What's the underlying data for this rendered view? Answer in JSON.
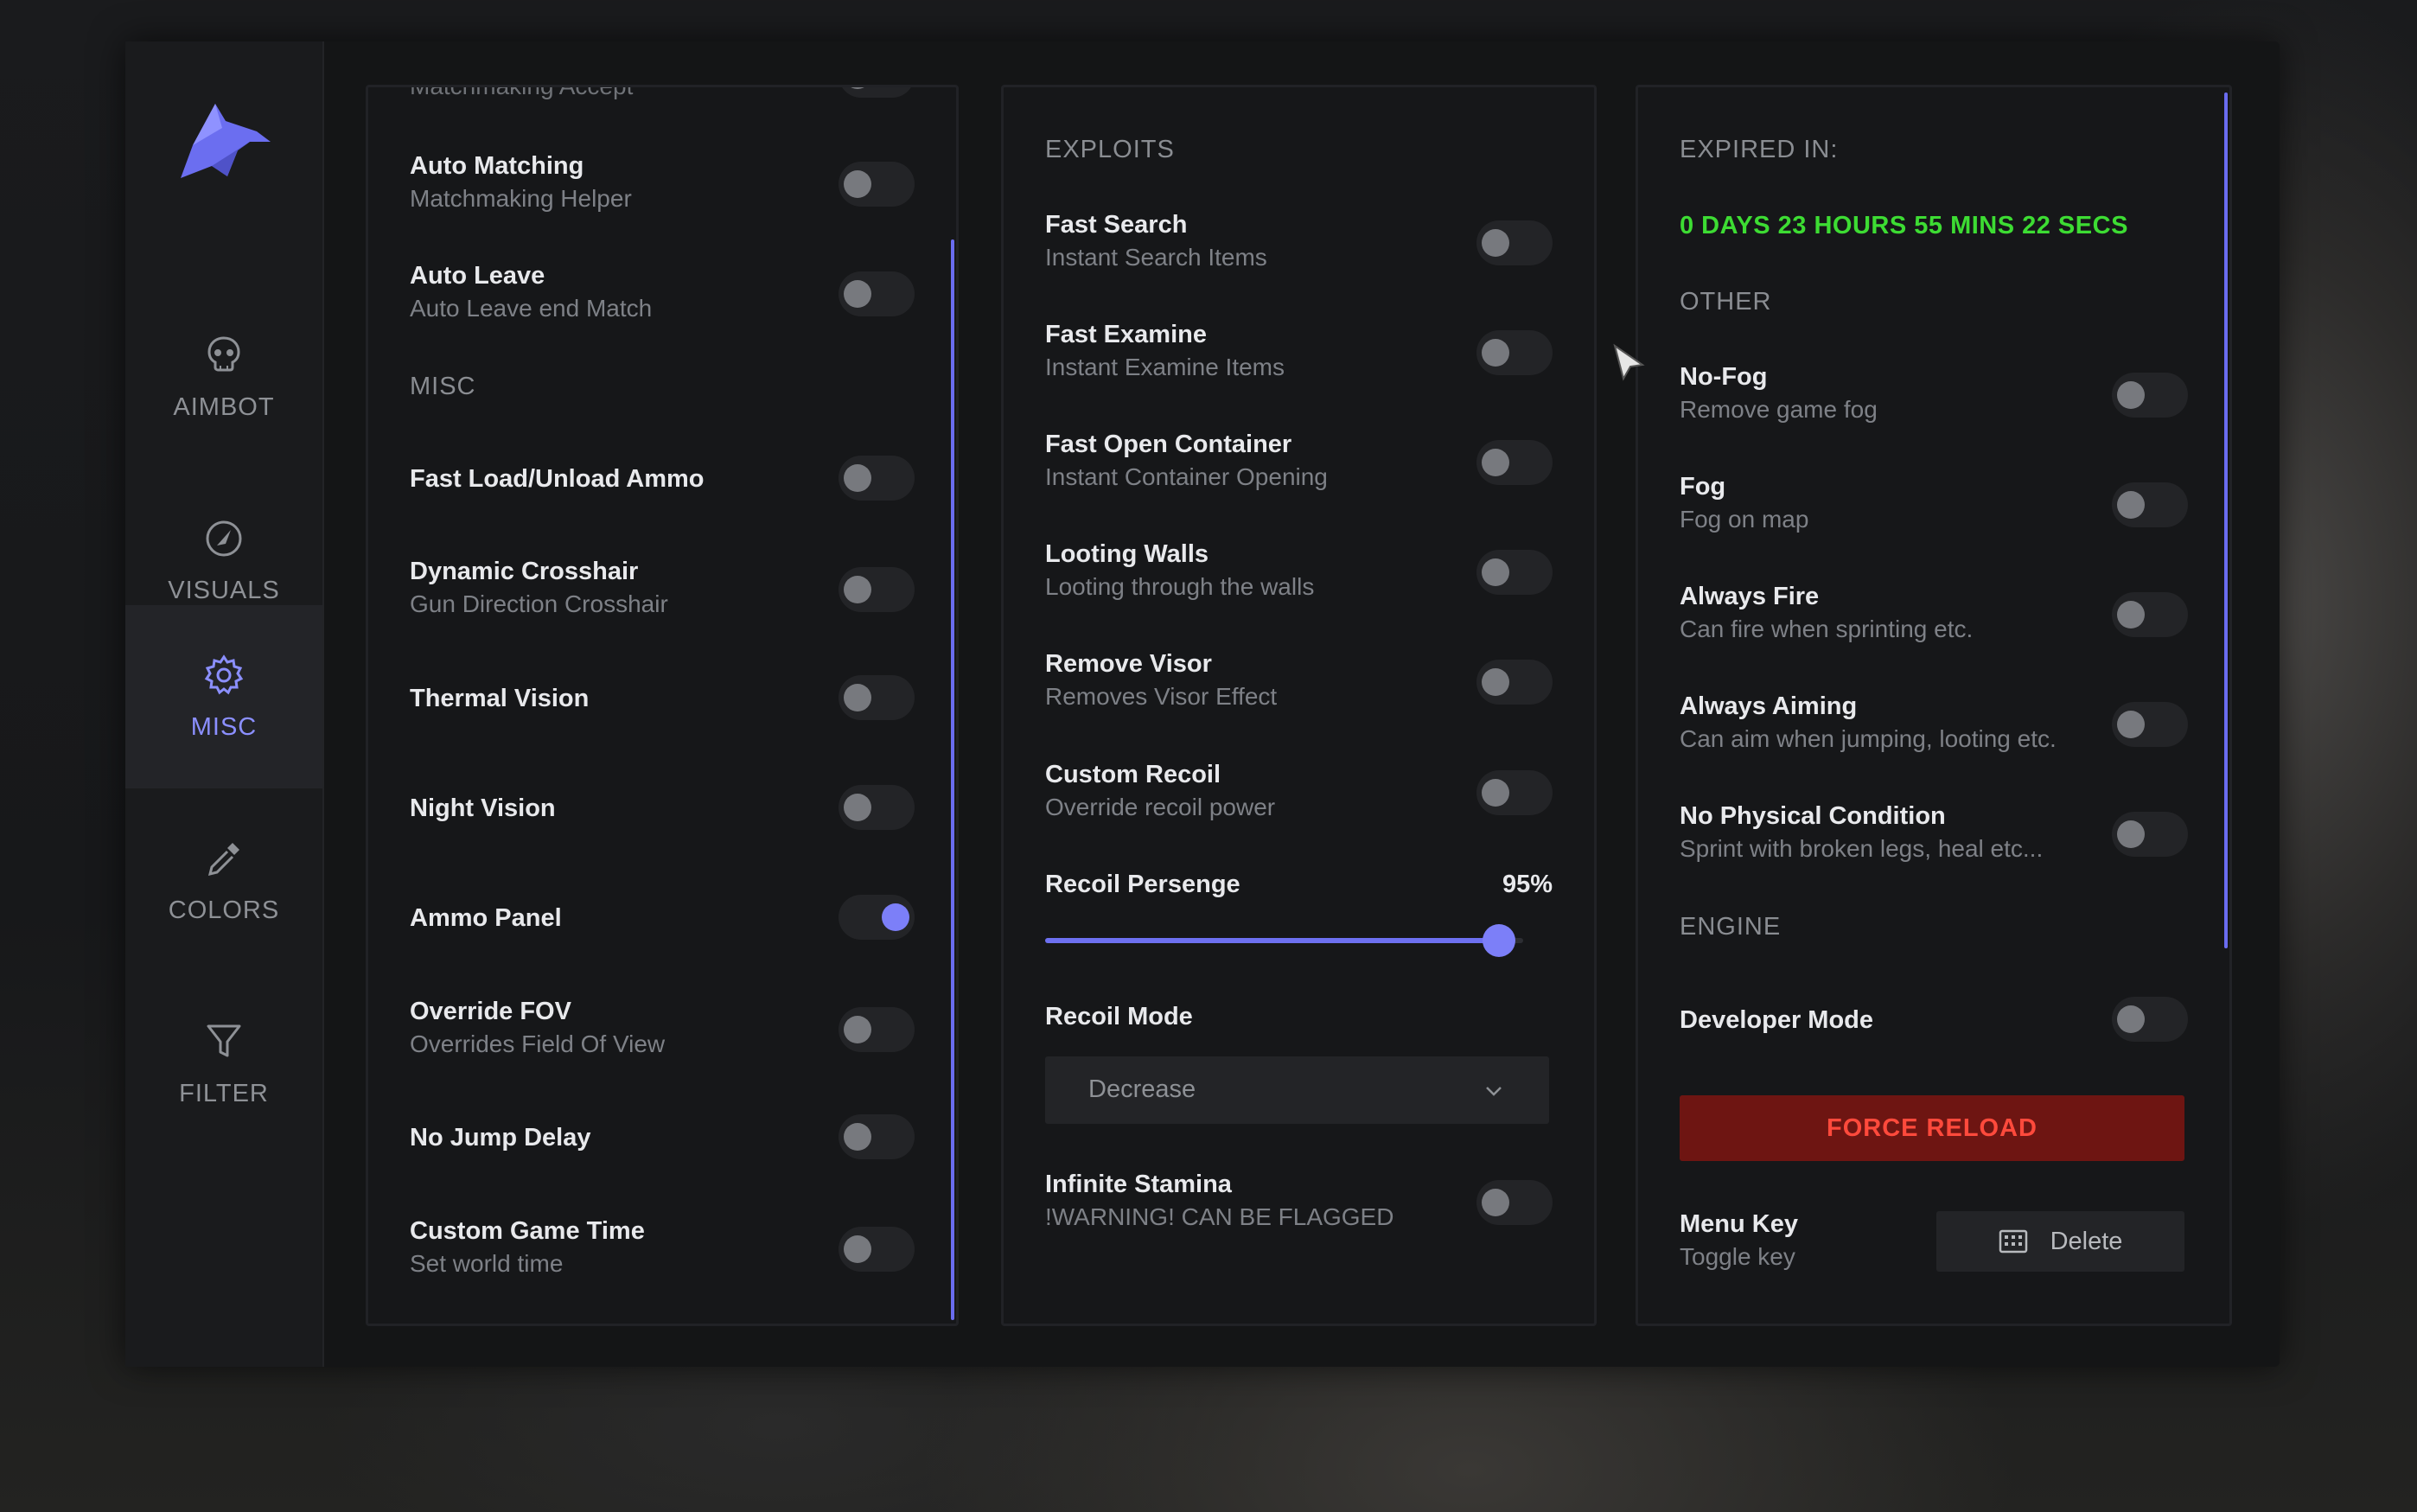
{
  "colors": {
    "accent": "#7c7ff8",
    "timer_green": "#3ddc33",
    "danger_red": "#ff4a3c",
    "danger_bg": "#6e1512"
  },
  "sidebar": {
    "logo_icon": "wolf-head-icon",
    "items": [
      {
        "label": "AIMBOT",
        "icon": "skull-icon",
        "active": false
      },
      {
        "label": "VISUALS",
        "icon": "gauge-icon",
        "active": false
      },
      {
        "label": "MISC",
        "icon": "gear-icon",
        "active": true
      },
      {
        "label": "COLORS",
        "icon": "eyedropper-icon",
        "active": false
      },
      {
        "label": "FILTER",
        "icon": "funnel-icon",
        "active": false
      }
    ]
  },
  "left_panel": {
    "top_cut_label": "Matchmaking Accept",
    "rows_a": [
      {
        "title": "Auto Matching",
        "subtitle": "Matchmaking Helper",
        "on": false
      },
      {
        "title": "Auto Leave",
        "subtitle": "Auto Leave end Match",
        "on": false
      }
    ],
    "misc_header": "MISC",
    "rows_b": [
      {
        "title": "Fast Load/Unload Ammo",
        "subtitle": "",
        "on": false
      },
      {
        "title": "Dynamic Crosshair",
        "subtitle": "Gun Direction Crosshair",
        "on": false
      },
      {
        "title": "Thermal Vision",
        "subtitle": "",
        "on": false
      },
      {
        "title": "Night Vision",
        "subtitle": "",
        "on": false
      },
      {
        "title": "Ammo Panel",
        "subtitle": "",
        "on": true
      },
      {
        "title": "Override FOV",
        "subtitle": "Overrides Field Of View",
        "on": false
      },
      {
        "title": "No Jump Delay",
        "subtitle": "",
        "on": false
      },
      {
        "title": "Custom Game Time",
        "subtitle": "Set world time",
        "on": false
      }
    ]
  },
  "mid_panel": {
    "header": "EXPLOITS",
    "rows": [
      {
        "title": "Fast Search",
        "subtitle": "Instant Search Items",
        "on": false
      },
      {
        "title": "Fast Examine",
        "subtitle": "Instant Examine Items",
        "on": false
      },
      {
        "title": "Fast Open Container",
        "subtitle": "Instant Container Opening",
        "on": false
      },
      {
        "title": "Looting Walls",
        "subtitle": "Looting through the walls",
        "on": false
      },
      {
        "title": "Remove Visor",
        "subtitle": "Removes Visor Effect",
        "on": false
      },
      {
        "title": "Custom Recoil",
        "subtitle": "Override recoil power",
        "on": false
      }
    ],
    "recoil": {
      "label": "Recoil Persenge",
      "value_text": "95%",
      "value": 95,
      "max": 100
    },
    "recoil_mode": {
      "label": "Recoil Mode",
      "selected": "Decrease"
    },
    "stamina": {
      "title": "Infinite Stamina",
      "subtitle": "!WARNING! CAN BE FLAGGED",
      "on": false
    }
  },
  "right_panel": {
    "expired_header": "EXPIRED IN:",
    "expired_value": "0 DAYS 23 HOURS 55 MINS 22 SECS",
    "other_header": "OTHER",
    "rows": [
      {
        "title": "No-Fog",
        "subtitle": "Remove game fog",
        "on": false
      },
      {
        "title": "Fog",
        "subtitle": "Fog on map",
        "on": false
      },
      {
        "title": "Always Fire",
        "subtitle": "Can fire when sprinting etc.",
        "on": false
      },
      {
        "title": "Always Aiming",
        "subtitle": "Can aim when jumping, looting etc.",
        "on": false
      },
      {
        "title": "No Physical Condition",
        "subtitle": "Sprint with broken legs, heal etc...",
        "on": false
      }
    ],
    "engine_header": "ENGINE",
    "developer": {
      "title": "Developer Mode",
      "on": false
    },
    "force_reload": "FORCE RELOAD",
    "menu_key": {
      "title": "Menu Key",
      "subtitle": "Toggle key",
      "key": "Delete",
      "key_icon": "keyboard-icon"
    }
  }
}
